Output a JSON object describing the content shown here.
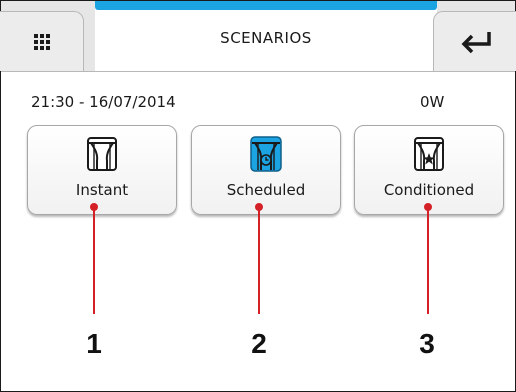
{
  "header": {
    "title": "SCENARIOS",
    "menu_icon": "grid-menu-icon",
    "back_icon": "return-arrow-icon"
  },
  "status": {
    "datetime": "21:30 - 16/07/2014",
    "power": "0W"
  },
  "scenarios": [
    {
      "label": "Instant",
      "icon": "curtain-icon",
      "selected": false
    },
    {
      "label": "Scheduled",
      "icon": "curtain-clock-icon",
      "selected": true
    },
    {
      "label": "Conditioned",
      "icon": "curtain-star-icon",
      "selected": false
    }
  ],
  "callouts": [
    "1",
    "2",
    "3"
  ],
  "colors": {
    "accent": "#1ca3e2",
    "callout": "#d42027"
  }
}
